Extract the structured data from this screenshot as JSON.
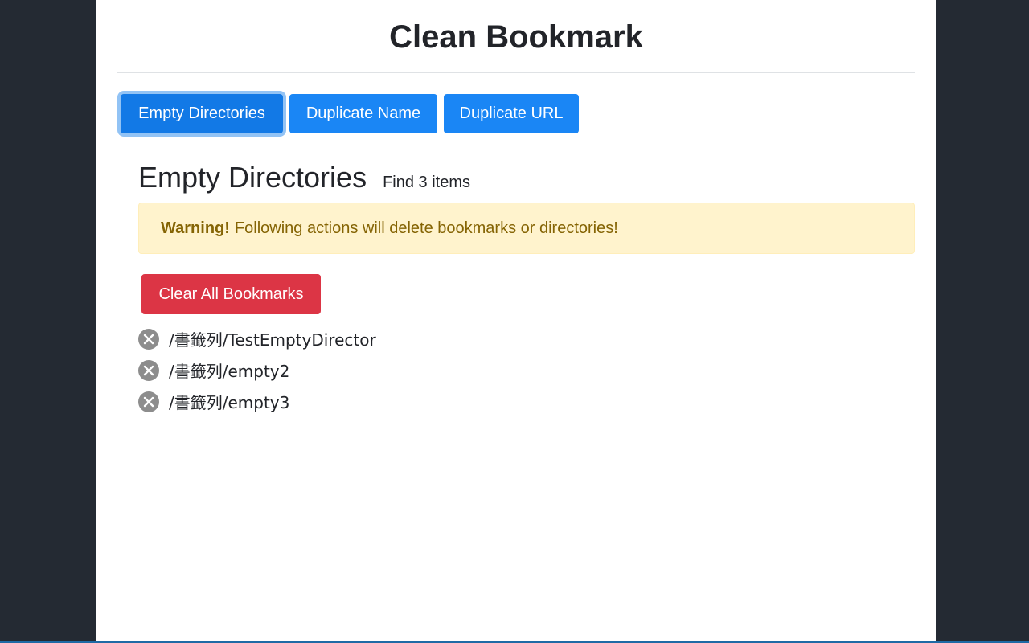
{
  "app": {
    "title": "Clean Bookmark"
  },
  "tabs": [
    {
      "label": "Empty Directories",
      "active": true
    },
    {
      "label": "Duplicate Name",
      "active": false
    },
    {
      "label": "Duplicate URL",
      "active": false
    }
  ],
  "section": {
    "title": "Empty Directories",
    "count_text": "Find 3 items"
  },
  "alert": {
    "strong": "Warning!",
    "text": "Following actions will delete bookmarks or directories!"
  },
  "actions": {
    "clear_all_label": "Clear All Bookmarks"
  },
  "items": [
    {
      "path": "/書籤列/TestEmptyDirector"
    },
    {
      "path": "/書籤列/empty2"
    },
    {
      "path": "/書籤列/empty3"
    }
  ],
  "icons": {
    "remove": "close-circle-icon"
  },
  "colors": {
    "primary": "#1a86f5",
    "danger": "#dc3545",
    "warning_bg": "#fff3cd",
    "warning_text": "#856404",
    "page_bg": "#242a33"
  }
}
